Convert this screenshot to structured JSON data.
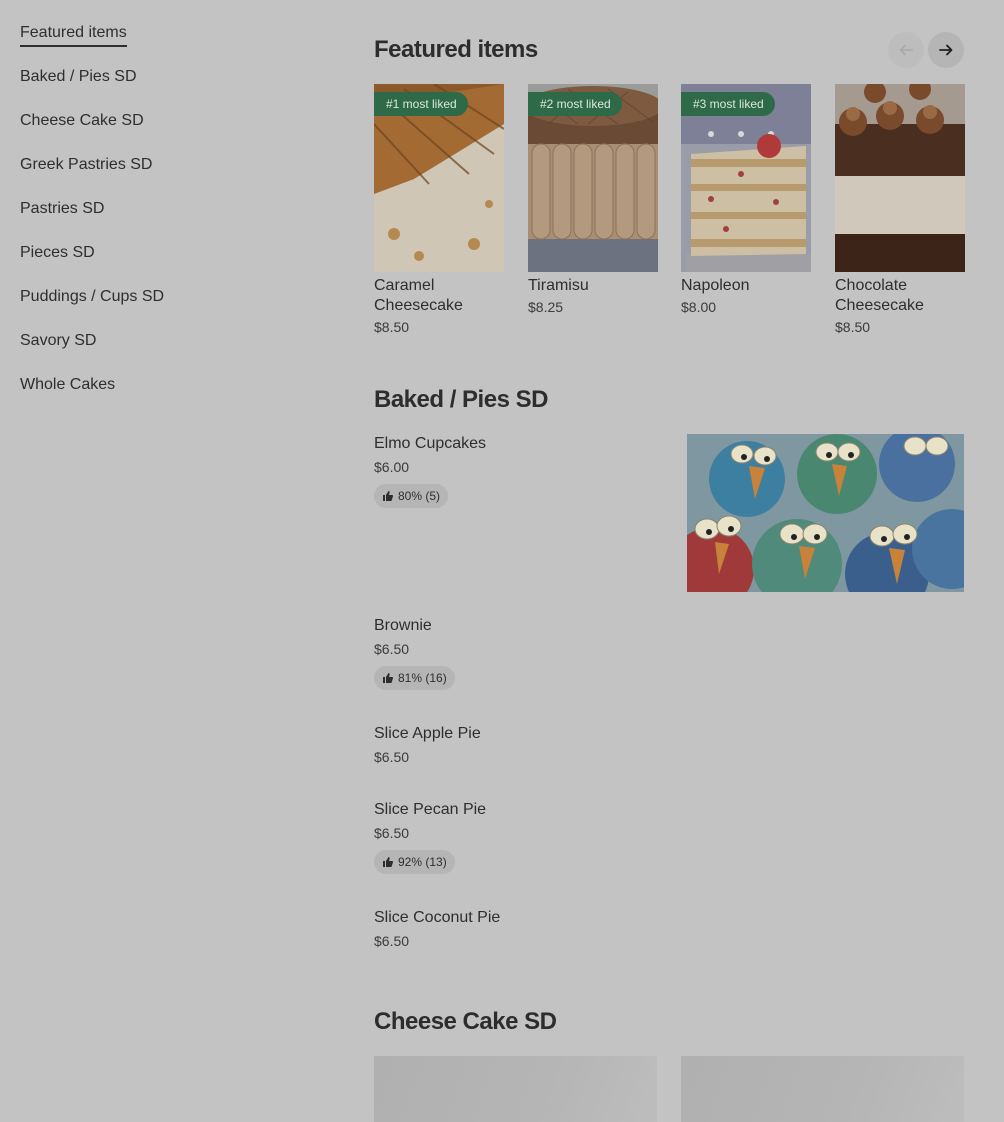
{
  "sidebar": {
    "items": [
      {
        "label": "Featured items",
        "active": true
      },
      {
        "label": "Baked / Pies SD"
      },
      {
        "label": "Cheese Cake SD"
      },
      {
        "label": "Greek Pastries SD"
      },
      {
        "label": "Pastries SD"
      },
      {
        "label": "Pieces SD"
      },
      {
        "label": "Puddings / Cups SD"
      },
      {
        "label": "Savory SD"
      },
      {
        "label": "Whole Cakes"
      }
    ]
  },
  "featured": {
    "title": "Featured items",
    "prev_icon": "arrow-left-icon",
    "next_icon": "arrow-right-icon",
    "items": [
      {
        "badge": "#1 most liked",
        "name": "Caramel Cheesecake",
        "price": "$8.50"
      },
      {
        "badge": "#2 most liked",
        "name": "Tiramisu",
        "price": "$8.25"
      },
      {
        "badge": "#3 most liked",
        "name": "Napoleon",
        "price": "$8.00"
      },
      {
        "badge": "",
        "name": "Chocolate Cheesecake",
        "price": "$8.50"
      }
    ]
  },
  "baked": {
    "title": "Baked / Pies SD",
    "items": [
      {
        "name": "Elmo Cupcakes",
        "price": "$6.00",
        "rating": "80% (5)"
      },
      {
        "name": "Brownie",
        "price": "$6.50",
        "rating": "81% (16)"
      },
      {
        "name": "Slice Apple Pie",
        "price": "$6.50",
        "rating": ""
      },
      {
        "name": "Slice Pecan Pie",
        "price": "$6.50",
        "rating": "92% (13)"
      },
      {
        "name": "Slice Coconut Pie",
        "price": "$6.50",
        "rating": ""
      }
    ]
  },
  "cheese": {
    "title": "Cheese Cake SD"
  },
  "colors": {
    "background": "#c3c3c3",
    "badge": "#2f6a48",
    "text": "#2e2e2e"
  }
}
